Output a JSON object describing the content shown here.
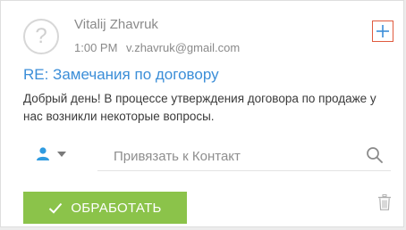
{
  "email": {
    "sender_name": "Vitalij Zhavruk",
    "time": "1:00 PM",
    "sender_email": "v.zhavruk@gmail.com",
    "subject": "RE: Замечания по договору",
    "body": "Добрый день! В процессе утверждения договора по продаже у нас возникли некоторые вопросы."
  },
  "link": {
    "placeholder": "Привязать к Контакт",
    "entity_icon": "person-icon"
  },
  "actions": {
    "process_label": "ОБРАБОТАТЬ"
  },
  "colors": {
    "accent": "#3b8ed8",
    "process_button": "#8bc34a",
    "highlight_border": "#e05a3e"
  }
}
